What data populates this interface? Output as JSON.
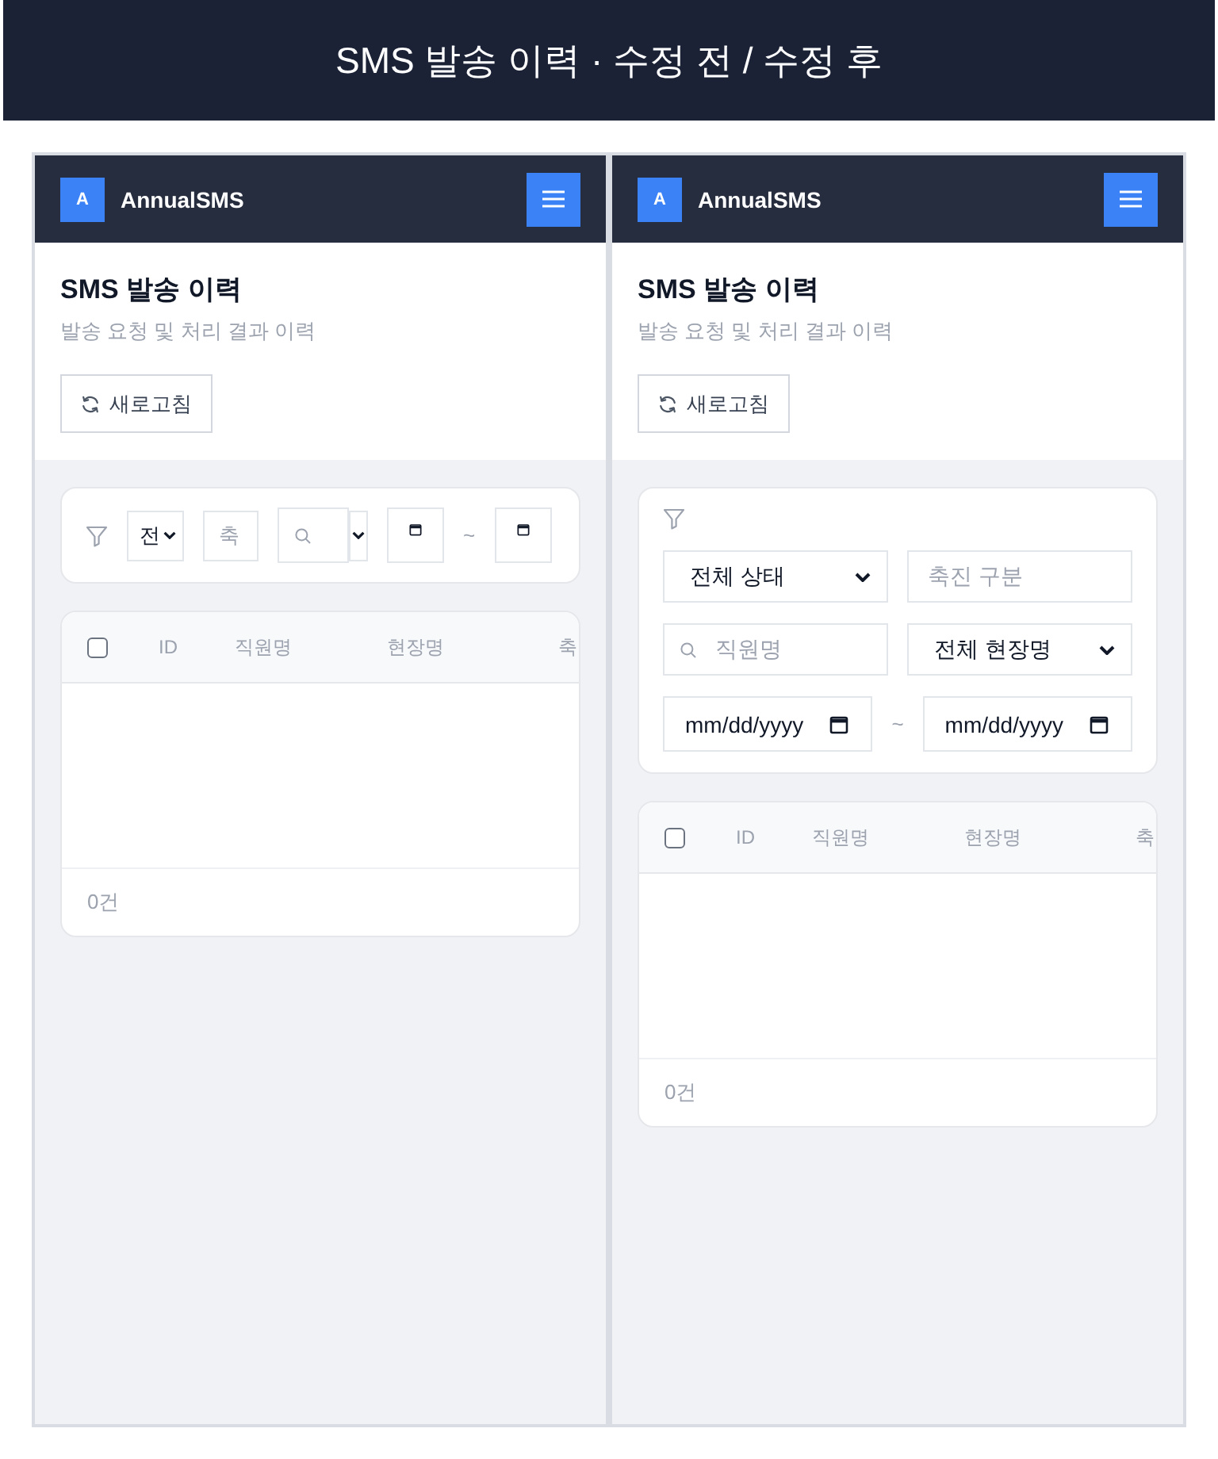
{
  "banner": {
    "title": "SMS 발송 이력 · 수정 전 / 수정 후"
  },
  "panels": [
    {
      "kind": "compact",
      "app_bar": {
        "logo": "A",
        "app_name": "AnnualSMS"
      },
      "header": {
        "title": "SMS 발송 이력",
        "subtitle": "발송 요청 및 처리 결과 이력",
        "refresh_button": "새로고침"
      },
      "filters": [
        {
          "kind": "select",
          "value": "전"
        },
        {
          "kind": "text",
          "placeholder": "축"
        },
        {
          "kind": "search"
        },
        {
          "kind": "select"
        },
        {
          "kind": "date"
        },
        {
          "kind": "separator",
          "text": "~"
        },
        {
          "kind": "date"
        }
      ],
      "table": {
        "select_all": {
          "checked": false
        },
        "columns": [
          "ID",
          "직원명",
          "현장명",
          "축"
        ],
        "footer": "0건"
      }
    },
    {
      "kind": "stacked",
      "app_bar": {
        "logo": "A",
        "app_name": "AnnualSMS"
      },
      "header": {
        "title": "SMS 발송 이력",
        "subtitle": "발송 요청 및 처리 결과 이력",
        "refresh_button": "새로고침"
      },
      "filters": [
        {
          "kind": "select",
          "value": "전체 상태"
        },
        {
          "kind": "text",
          "placeholder": "축진 구분"
        },
        {
          "kind": "search",
          "placeholder": "직원명"
        },
        {
          "kind": "select",
          "value": "전체 현장명"
        },
        {
          "kind": "date",
          "placeholder": "mm/dd/yyyy"
        },
        {
          "kind": "separator",
          "text": "~"
        },
        {
          "kind": "date",
          "placeholder": "mm/dd/yyyy"
        }
      ],
      "table": {
        "select_all": {
          "checked": false
        },
        "columns": [
          "ID",
          "직원명",
          "현장명",
          "축"
        ],
        "footer": "0건"
      }
    }
  ]
}
